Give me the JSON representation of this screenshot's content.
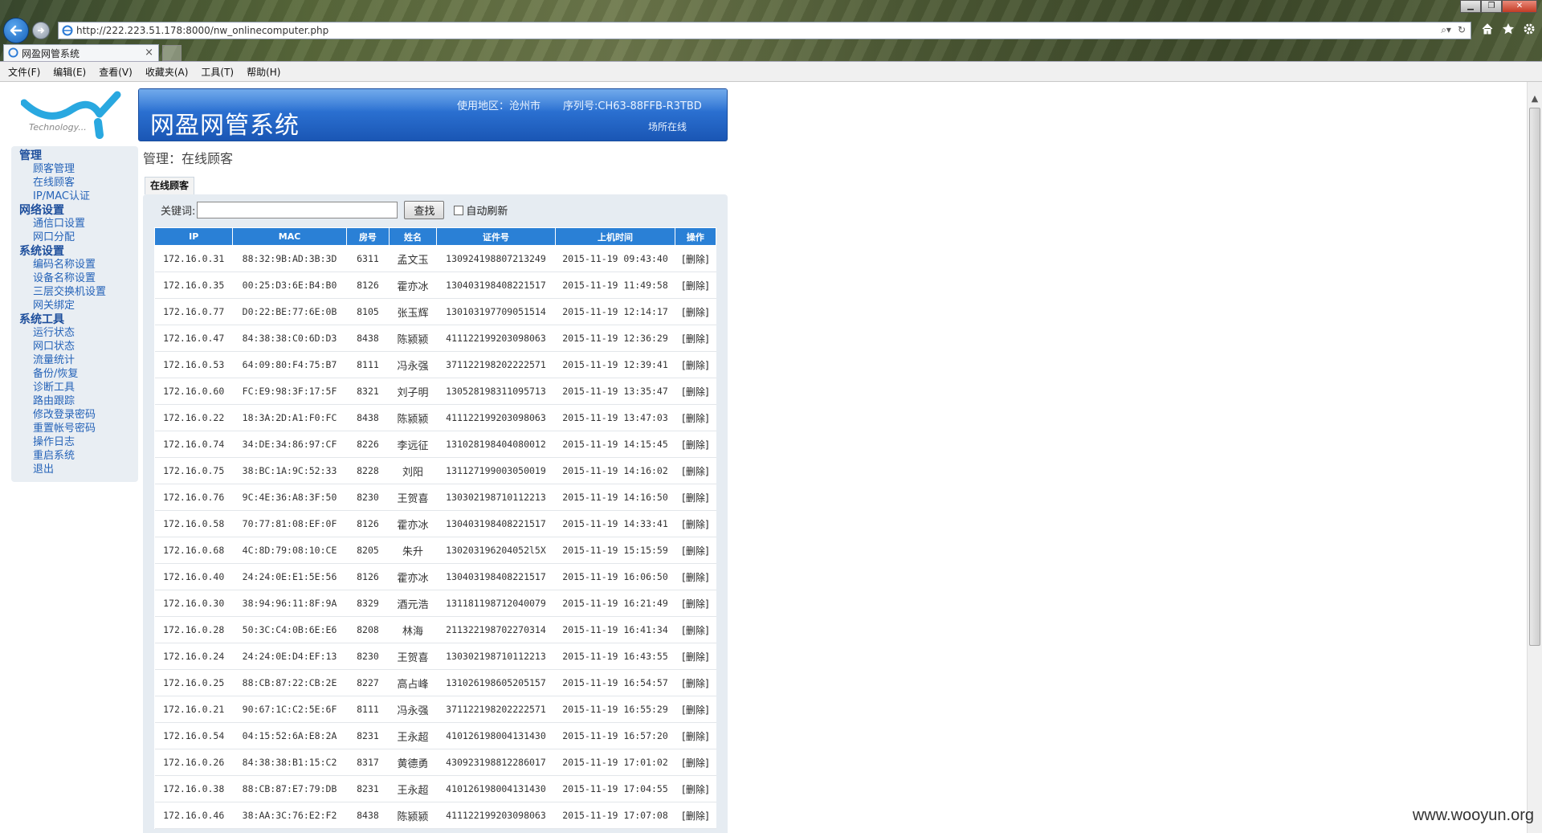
{
  "browser": {
    "url": "http://222.223.51.178:8000/nw_onlinecomputer.php",
    "tab_title": "网盈网管系统",
    "tab_close": "×",
    "menu": [
      "文件(F)",
      "编辑(E)",
      "查看(V)",
      "收藏夹(A)",
      "工具(T)",
      "帮助(H)"
    ],
    "addr_icons": [
      "search-icon",
      "refresh-icon"
    ],
    "toolbar_icons": [
      "home-icon",
      "favorites-star-icon",
      "settings-gear-icon"
    ]
  },
  "logo": {
    "text": "Technology..."
  },
  "banner": {
    "title": "网盈网管系统",
    "region": "使用地区：沧州市",
    "serial": "序列号:CH63-88FFB-R3TBD",
    "venue": "场所在线"
  },
  "sidebar": {
    "groups": [
      {
        "title": "管理",
        "items": [
          "顾客管理",
          "在线顾客",
          "IP/MAC认证"
        ]
      },
      {
        "title": "网络设置",
        "items": [
          "通信口设置",
          "网口分配"
        ]
      },
      {
        "title": "系统设置",
        "items": [
          "编码名称设置",
          "设备名称设置",
          "三层交换机设置",
          "网关绑定"
        ]
      },
      {
        "title": "系统工具",
        "items": [
          "运行状态",
          "网口状态",
          "流量统计",
          "备份/恢复",
          "诊断工具",
          "路由跟踪",
          "修改登录密码",
          "重置帐号密码",
          "操作日志",
          "重启系统",
          "退出"
        ]
      }
    ]
  },
  "main": {
    "heading": "管理：在线顾客",
    "section_tab": "在线顾客",
    "search": {
      "label": "关键词:",
      "value": "",
      "button": "查找",
      "auto_refresh": "自动刷新",
      "auto_refresh_checked": false
    },
    "columns": [
      "IP",
      "MAC",
      "房号",
      "姓名",
      "证件号",
      "上机时间",
      "操作"
    ],
    "rows": [
      [
        "172.16.0.31",
        "88:32:9B:AD:3B:3D",
        "6311",
        "孟文玉",
        "130924198807213249",
        "2015-11-19 09:43:40",
        "[删除]"
      ],
      [
        "172.16.0.35",
        "00:25:D3:6E:B4:B0",
        "8126",
        "霍亦冰",
        "130403198408221517",
        "2015-11-19 11:49:58",
        "[删除]"
      ],
      [
        "172.16.0.77",
        "D0:22:BE:77:6E:0B",
        "8105",
        "张玉辉",
        "130103197709051514",
        "2015-11-19 12:14:17",
        "[删除]"
      ],
      [
        "172.16.0.47",
        "84:38:38:C0:6D:D3",
        "8438",
        "陈颍颍",
        "411122199203098063",
        "2015-11-19 12:36:29",
        "[删除]"
      ],
      [
        "172.16.0.53",
        "64:09:80:F4:75:B7",
        "8111",
        "冯永强",
        "371122198202222571",
        "2015-11-19 12:39:41",
        "[删除]"
      ],
      [
        "172.16.0.60",
        "FC:E9:98:3F:17:5F",
        "8321",
        "刘子明",
        "130528198311095713",
        "2015-11-19 13:35:47",
        "[删除]"
      ],
      [
        "172.16.0.22",
        "18:3A:2D:A1:F0:FC",
        "8438",
        "陈颍颍",
        "411122199203098063",
        "2015-11-19 13:47:03",
        "[删除]"
      ],
      [
        "172.16.0.74",
        "34:DE:34:86:97:CF",
        "8226",
        "李远征",
        "131028198404080012",
        "2015-11-19 14:15:45",
        "[删除]"
      ],
      [
        "172.16.0.75",
        "38:BC:1A:9C:52:33",
        "8228",
        "刘阳",
        "131127199003050019",
        "2015-11-19 14:16:02",
        "[删除]"
      ],
      [
        "172.16.0.76",
        "9C:4E:36:A8:3F:50",
        "8230",
        "王贺喜",
        "130302198710112213",
        "2015-11-19 14:16:50",
        "[删除]"
      ],
      [
        "172.16.0.58",
        "70:77:81:08:EF:0F",
        "8126",
        "霍亦冰",
        "130403198408221517",
        "2015-11-19 14:33:41",
        "[删除]"
      ],
      [
        "172.16.0.68",
        "4C:8D:79:08:10:CE",
        "8205",
        "朱升",
        "130203196204052l5X",
        "2015-11-19 15:15:59",
        "[删除]"
      ],
      [
        "172.16.0.40",
        "24:24:0E:E1:5E:56",
        "8126",
        "霍亦冰",
        "130403198408221517",
        "2015-11-19 16:06:50",
        "[删除]"
      ],
      [
        "172.16.0.30",
        "38:94:96:11:8F:9A",
        "8329",
        "酒元浩",
        "131181198712040079",
        "2015-11-19 16:21:49",
        "[删除]"
      ],
      [
        "172.16.0.28",
        "50:3C:C4:0B:6E:E6",
        "8208",
        "林海",
        "211322198702270314",
        "2015-11-19 16:41:34",
        "[删除]"
      ],
      [
        "172.16.0.24",
        "24:24:0E:D4:EF:13",
        "8230",
        "王贺喜",
        "130302198710112213",
        "2015-11-19 16:43:55",
        "[删除]"
      ],
      [
        "172.16.0.25",
        "88:CB:87:22:CB:2E",
        "8227",
        "高占峰",
        "131026198605205157",
        "2015-11-19 16:54:57",
        "[删除]"
      ],
      [
        "172.16.0.21",
        "90:67:1C:C2:5E:6F",
        "8111",
        "冯永强",
        "371122198202222571",
        "2015-11-19 16:55:29",
        "[删除]"
      ],
      [
        "172.16.0.54",
        "04:15:52:6A:E8:2A",
        "8231",
        "王永超",
        "410126198004131430",
        "2015-11-19 16:57:20",
        "[删除]"
      ],
      [
        "172.16.0.26",
        "84:38:38:B1:15:C2",
        "8317",
        "黄德勇",
        "430923198812286017",
        "2015-11-19 17:01:02",
        "[删除]"
      ],
      [
        "172.16.0.38",
        "88:CB:87:E7:79:DB",
        "8231",
        "王永超",
        "410126198004131430",
        "2015-11-19 17:04:55",
        "[删除]"
      ],
      [
        "172.16.0.46",
        "38:AA:3C:76:E2:F2",
        "8438",
        "陈颍颍",
        "411122199203098063",
        "2015-11-19 17:07:08",
        "[删除]"
      ]
    ]
  },
  "watermark": "www.wooyun.org"
}
